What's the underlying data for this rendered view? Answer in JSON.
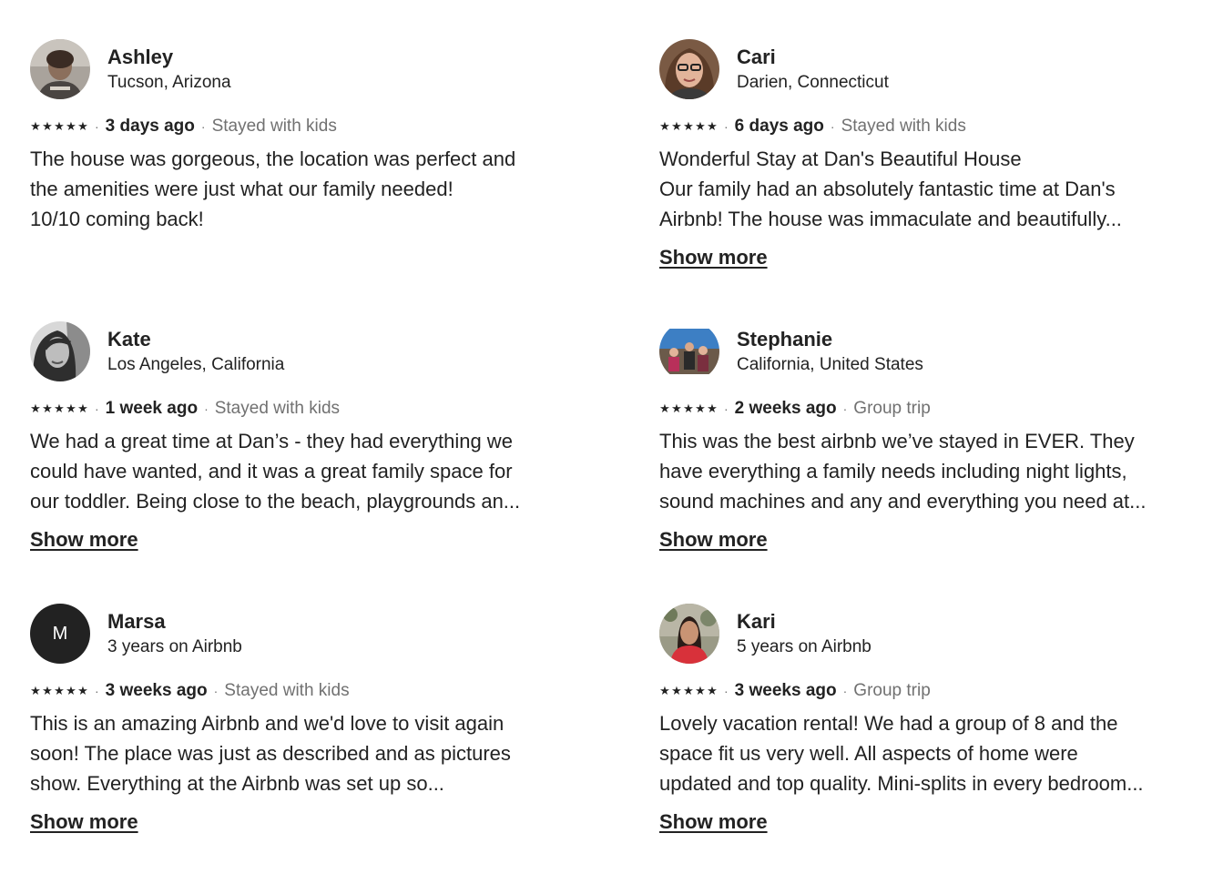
{
  "reviews": [
    {
      "name": "Ashley",
      "location": "Tucson, Arizona",
      "rating": 5,
      "when": "3 days ago",
      "trip": "Stayed with kids",
      "text": "The house was gorgeous, the location was perfect and\nthe amenities were just what our family needed!\n10/10 coming back!",
      "show_more": ""
    },
    {
      "name": "Cari",
      "location": "Darien, Connecticut",
      "rating": 5,
      "when": "6 days ago",
      "trip": "Stayed with kids",
      "text": "Wonderful Stay at Dan's Beautiful House\nOur family had an absolutely fantastic time at Dan's\nAirbnb! The house was immaculate and beautifully...",
      "show_more": "Show more"
    },
    {
      "name": "Kate",
      "location": "Los Angeles, California",
      "rating": 5,
      "when": "1 week ago",
      "trip": "Stayed with kids",
      "text": "We had a great time at Dan’s - they had everything we\ncould have wanted, and it was a great family space for\nour toddler. Being close to the beach, playgrounds an...",
      "show_more": "Show more"
    },
    {
      "name": "Stephanie",
      "location": "California, United States",
      "rating": 5,
      "when": "2 weeks ago",
      "trip": "Group trip",
      "text": "This was the best airbnb we’ve stayed in EVER. They\nhave everything a family needs including night lights,\nsound machines and any and everything you need at...",
      "show_more": "Show more"
    },
    {
      "name": "Marsa",
      "location": "3 years on Airbnb",
      "rating": 5,
      "when": "3 weeks ago",
      "trip": "Stayed with kids",
      "avatar_initial": "M",
      "text": "This is an amazing Airbnb and we'd love to visit again\nsoon! The place was just as described and as pictures\nshow. Everything at the Airbnb was set up so...",
      "show_more": "Show more"
    },
    {
      "name": "Kari",
      "location": "5 years on Airbnb",
      "rating": 5,
      "when": "3 weeks ago",
      "trip": "Group trip",
      "text": "Lovely vacation rental! We had a group of 8 and the\nspace fit us very well. All aspects of home were\nupdated and top quality. Mini-splits in every bedroom...",
      "show_more": "Show more"
    }
  ],
  "icons": {
    "star": "star-icon",
    "separator": "·"
  }
}
